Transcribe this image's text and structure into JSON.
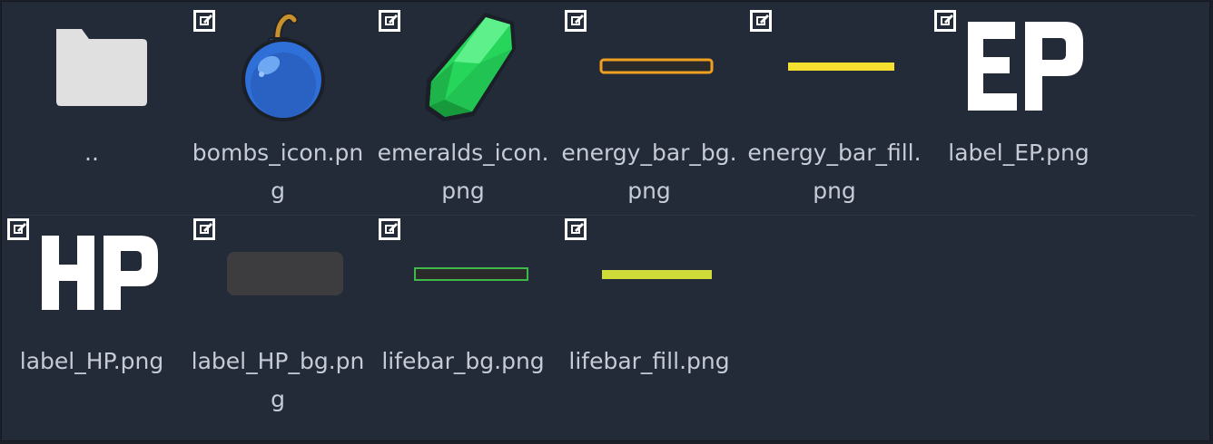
{
  "file_browser": {
    "items": [
      {
        "name": "..",
        "kind": "folder",
        "icon": "folder-icon"
      },
      {
        "name": "bombs_icon.png",
        "kind": "image",
        "icon": "bomb-icon"
      },
      {
        "name": "emeralds_icon.png",
        "kind": "image",
        "icon": "emerald-icon"
      },
      {
        "name": "energy_bar_bg.png",
        "kind": "image",
        "icon": "energy-bar-bg-preview"
      },
      {
        "name": "energy_bar_fill.png",
        "kind": "image",
        "icon": "energy-bar-fill-preview"
      },
      {
        "name": "label_EP.png",
        "kind": "image",
        "icon": "label-ep-preview",
        "preview_text": "EP"
      },
      {
        "name": "label_HP.png",
        "kind": "image",
        "icon": "label-hp-preview",
        "preview_text": "HP"
      },
      {
        "name": "label_HP_bg.png",
        "kind": "image",
        "icon": "label-hp-bg-preview"
      },
      {
        "name": "lifebar_bg.png",
        "kind": "image",
        "icon": "lifebar-bg-preview"
      },
      {
        "name": "lifebar_fill.png",
        "kind": "image",
        "icon": "lifebar-fill-preview"
      }
    ]
  },
  "colors": {
    "panel_bg": "#232a38",
    "label_text": "#c6cbd6",
    "folder": "#e0e0e0",
    "energy_bar_outline": "#f0a020",
    "energy_bar_fill": "#f5e030",
    "lifebar_outline": "#3fb84a",
    "lifebar_fill": "#cfdb38",
    "hp_bg": "#3d3d3f"
  }
}
